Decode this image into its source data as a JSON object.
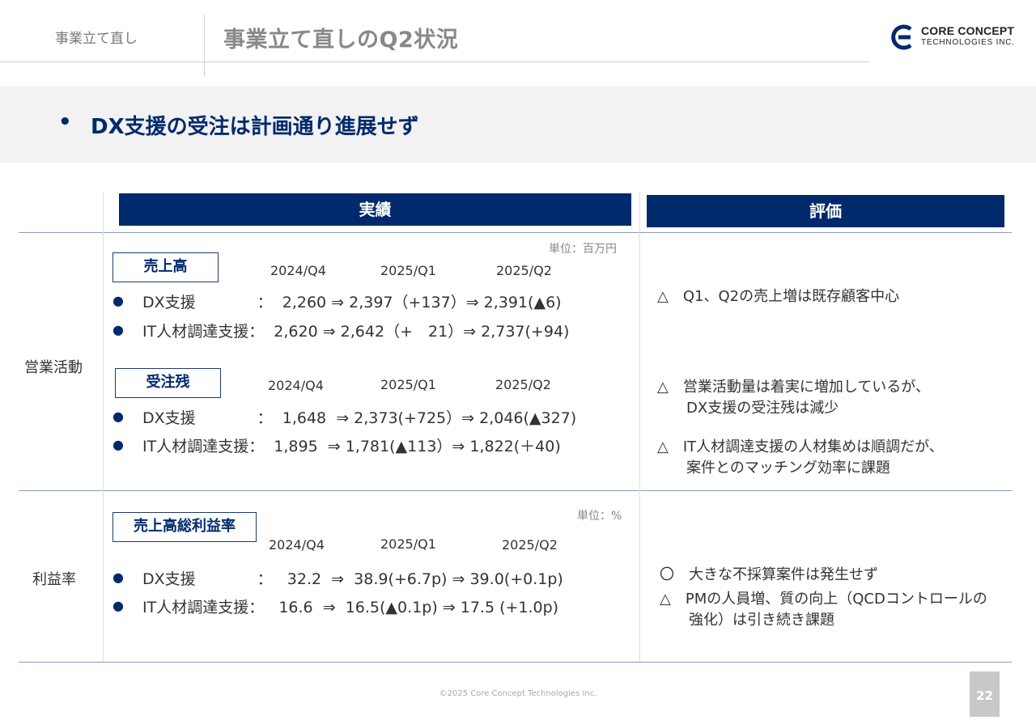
{
  "header": {
    "section": "事業立て直し",
    "title": "事業立て直しのQ2状況",
    "logo_line1": "CORE CONCEPT",
    "logo_line2": "TECHNOLOGIES INC."
  },
  "banner": {
    "bullet": "•",
    "text": "DX支援の受注は計画通り進展せず"
  },
  "columns": {
    "result": "実績",
    "evaluation": "評価"
  },
  "rows": {
    "sales_activity": {
      "label": "営業活動",
      "unit": "単位：百万円",
      "revenue": {
        "title": "売上高",
        "periods": [
          "2024/Q4",
          "2025/Q1",
          "2025/Q2"
        ],
        "lines": [
          {
            "bullet": "●",
            "text": "DX支援　　　　：  2,260 ⇒ 2,397（+137）⇒ 2,391(▲6)"
          },
          {
            "bullet": "●",
            "text": "IT人材調達支援：  2,620 ⇒ 2,642（+　21）⇒ 2,737(+94)"
          }
        ]
      },
      "backlog": {
        "title": "受注残",
        "periods": [
          "2024/Q4",
          "2025/Q1",
          "2025/Q2"
        ],
        "lines": [
          {
            "bullet": "●",
            "text": "DX支援　　　　：  1,648  ⇒ 2,373(+725）⇒ 2,046(▲327)"
          },
          {
            "bullet": "●",
            "text": "IT人材調達支援：  1,895  ⇒ 1,781(▲113）⇒ 1,822(＋40)"
          }
        ]
      },
      "evaluation": [
        "△　Q1、Q2の売上増は既存顧客中心",
        "△　営業活動量は着実に増加しているが、\n　　DX支援の受注残は減少",
        "△　IT人材調達支援の人材集めは順調だが、\n　　案件とのマッチング効率に課題"
      ]
    },
    "margin": {
      "label": "利益率",
      "unit": "単位：%",
      "gross_margin": {
        "title": "売上高総利益率",
        "periods": [
          "2024/Q4",
          "2025/Q1",
          "2025/Q2"
        ],
        "lines": [
          {
            "bullet": "●",
            "text": "DX支援　　　　：   32.2  ⇒  38.9(+6.7p) ⇒ 39.0(+0.1p)"
          },
          {
            "bullet": "●",
            "text": "IT人材調達支援：   16.6  ⇒  16.5(▲0.1p) ⇒ 17.5 (+1.0p)"
          }
        ]
      },
      "evaluation": [
        "〇　大きな不採算案件は発生せず",
        "△　PMの人員増、質の向上（QCDコントロールの\n　　強化）は引き続き課題"
      ]
    }
  },
  "footer": {
    "copyright": "©2025 Core Concept Technologies Inc.",
    "page": "22"
  },
  "colors": {
    "navy": "#002a6c",
    "banner_bg": "#f2f2f2"
  }
}
